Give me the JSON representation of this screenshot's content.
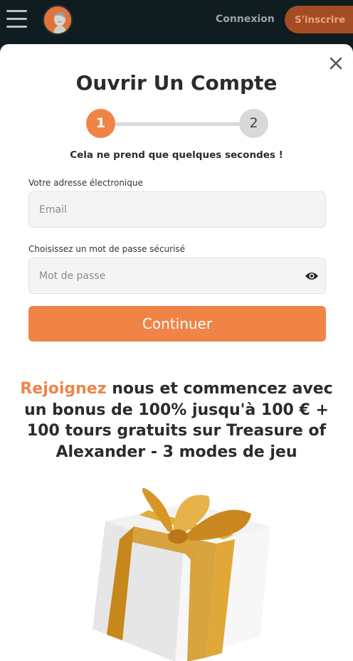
{
  "header": {
    "login_label": "Connexion",
    "signup_label": "S'inscrire"
  },
  "modal": {
    "title": "Ouvrir Un Compte",
    "steps": [
      "1",
      "2"
    ],
    "subtitle": "Cela ne prend que quelques secondes !",
    "email": {
      "label": "Votre adresse électronique",
      "placeholder": "Email",
      "value": ""
    },
    "password": {
      "label": "Choisissez un mot de passe sécurisé",
      "placeholder": "Mot de passe",
      "value": ""
    },
    "continue_label": "Continuer"
  },
  "promo": {
    "accent_text": "Rejoignez",
    "text": " nous et commencez avec un bonus de 100% jusqu'à 100 € + 100 tours gratuits sur Treasure of Alexander - 3 modes de jeu"
  },
  "colors": {
    "accent": "#f08447",
    "header_bg": "#0f1c20",
    "signup_bg": "#a64c24"
  },
  "icons": [
    "menu-icon",
    "avatar-logo",
    "close-icon",
    "eye-icon",
    "gift-image"
  ]
}
